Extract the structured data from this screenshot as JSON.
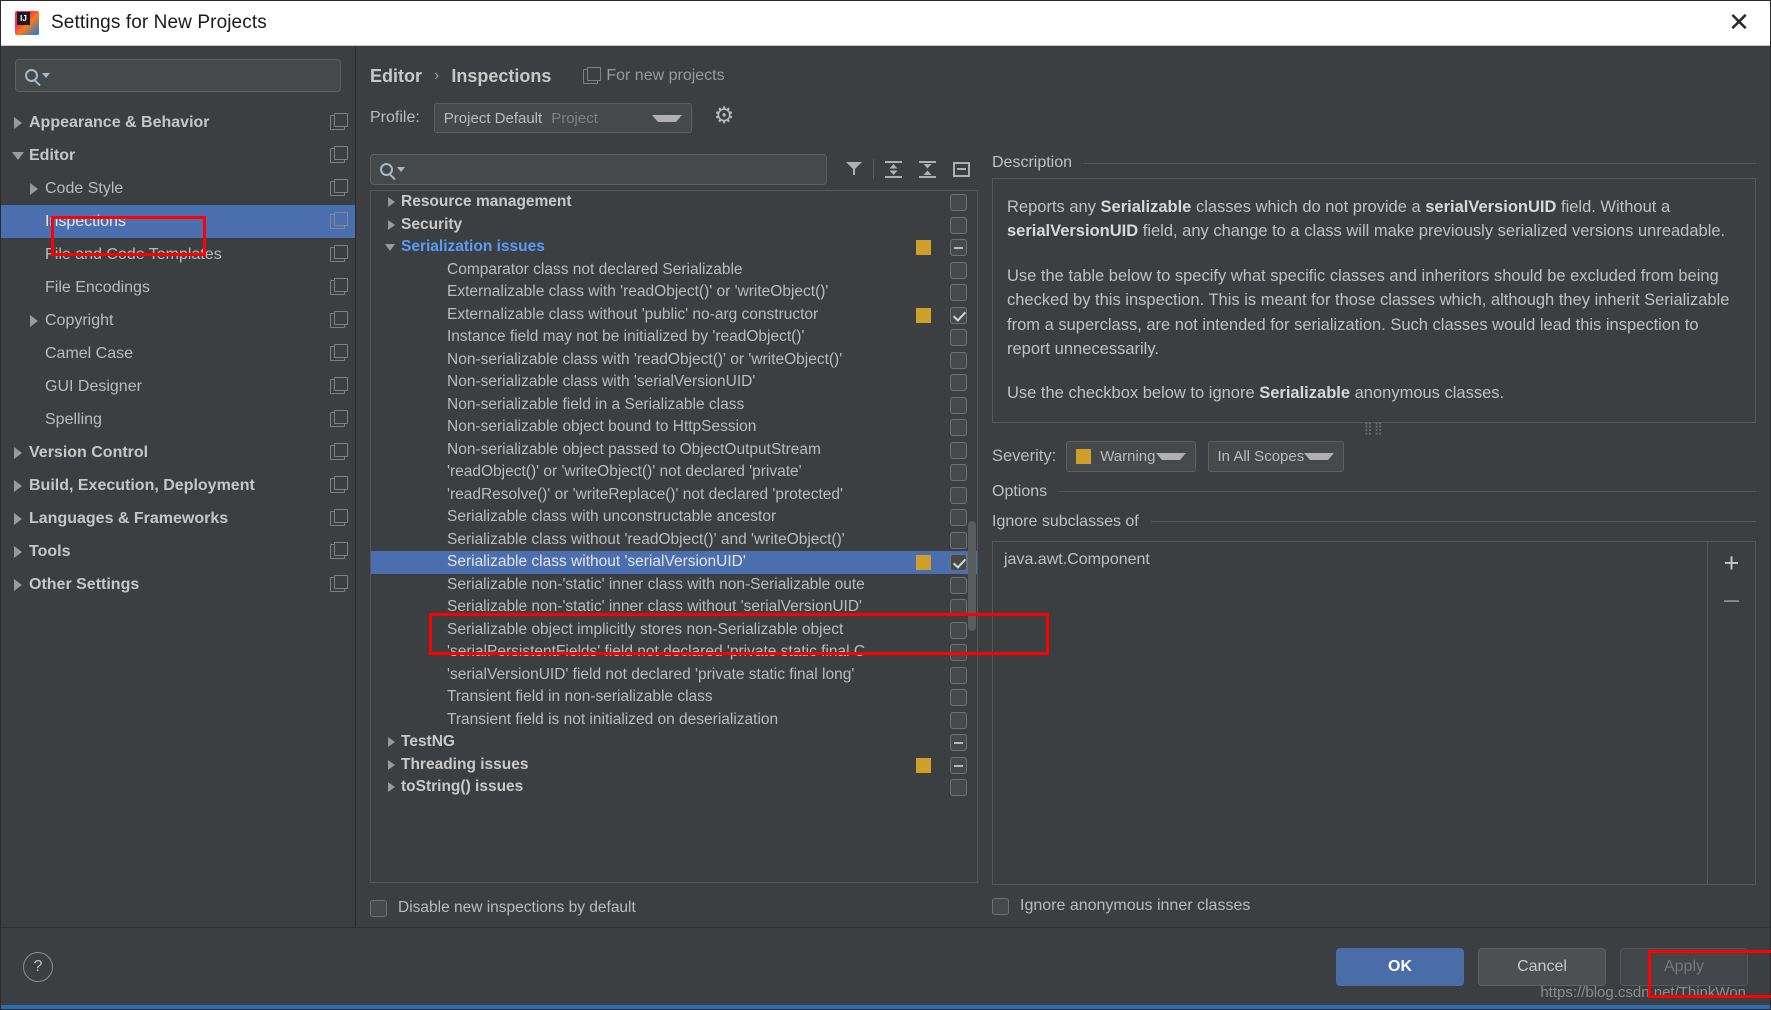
{
  "window": {
    "title": "Settings for New Projects",
    "close_label": "✕",
    "logo": "intellij-idea-logo"
  },
  "sidebar": {
    "search_placeholder": "",
    "search_value": "",
    "items": [
      {
        "label": "Appearance & Behavior",
        "level": 0,
        "bold": true,
        "arrow": "right",
        "selected": false
      },
      {
        "label": "Editor",
        "level": 0,
        "bold": true,
        "arrow": "down",
        "selected": false
      },
      {
        "label": "Code Style",
        "level": 1,
        "bold": false,
        "arrow": "right",
        "selected": false
      },
      {
        "label": "Inspections",
        "level": 1,
        "bold": false,
        "arrow": "none",
        "selected": true
      },
      {
        "label": "File and Code Templates",
        "level": 1,
        "bold": false,
        "arrow": "none",
        "selected": false
      },
      {
        "label": "File Encodings",
        "level": 1,
        "bold": false,
        "arrow": "none",
        "selected": false
      },
      {
        "label": "Copyright",
        "level": 1,
        "bold": false,
        "arrow": "right",
        "selected": false
      },
      {
        "label": "Camel Case",
        "level": 1,
        "bold": false,
        "arrow": "none",
        "selected": false
      },
      {
        "label": "GUI Designer",
        "level": 1,
        "bold": false,
        "arrow": "none",
        "selected": false
      },
      {
        "label": "Spelling",
        "level": 1,
        "bold": false,
        "arrow": "none",
        "selected": false
      },
      {
        "label": "Version Control",
        "level": 0,
        "bold": true,
        "arrow": "right",
        "selected": false
      },
      {
        "label": "Build, Execution, Deployment",
        "level": 0,
        "bold": true,
        "arrow": "right",
        "selected": false
      },
      {
        "label": "Languages & Frameworks",
        "level": 0,
        "bold": true,
        "arrow": "right",
        "selected": false
      },
      {
        "label": "Tools",
        "level": 0,
        "bold": true,
        "arrow": "right",
        "selected": false
      },
      {
        "label": "Other Settings",
        "level": 0,
        "bold": true,
        "arrow": "right",
        "selected": false
      }
    ]
  },
  "header": {
    "breadcrumb": [
      "Editor",
      "Inspections"
    ],
    "separator": "›",
    "for_new_projects": "For new projects",
    "profile_label": "Profile:",
    "profile_value": "Project Default",
    "profile_scope": "Project",
    "gear_icon": "gear-icon"
  },
  "inspections": {
    "search_value": "",
    "toolbar": [
      "filter-icon",
      "expand-all-icon",
      "collapse-all-icon",
      "minus-box-icon"
    ],
    "rows": [
      {
        "label": "Resource management",
        "type": "group",
        "arrow": "right",
        "active": false,
        "severity": false,
        "checkbox": "empty",
        "selected": false
      },
      {
        "label": "Security",
        "type": "group",
        "arrow": "right",
        "active": false,
        "severity": false,
        "checkbox": "empty",
        "selected": false
      },
      {
        "label": "Serialization issues",
        "type": "group",
        "arrow": "down",
        "active": true,
        "severity": true,
        "checkbox": "dash",
        "selected": false
      },
      {
        "label": "Comparator class not declared Serializable",
        "type": "leaf",
        "severity": false,
        "checkbox": "empty",
        "selected": false
      },
      {
        "label": "Externalizable class with 'readObject()' or 'writeObject()'",
        "type": "leaf",
        "severity": false,
        "checkbox": "empty",
        "selected": false
      },
      {
        "label": "Externalizable class without 'public' no-arg constructor",
        "type": "leaf",
        "severity": true,
        "checkbox": "checked",
        "selected": false
      },
      {
        "label": "Instance field may not be initialized by 'readObject()'",
        "type": "leaf",
        "severity": false,
        "checkbox": "empty",
        "selected": false
      },
      {
        "label": "Non-serializable class with 'readObject()' or 'writeObject()'",
        "type": "leaf",
        "severity": false,
        "checkbox": "empty",
        "selected": false
      },
      {
        "label": "Non-serializable class with 'serialVersionUID'",
        "type": "leaf",
        "severity": false,
        "checkbox": "empty",
        "selected": false
      },
      {
        "label": "Non-serializable field in a Serializable class",
        "type": "leaf",
        "severity": false,
        "checkbox": "empty",
        "selected": false
      },
      {
        "label": "Non-serializable object bound to HttpSession",
        "type": "leaf",
        "severity": false,
        "checkbox": "empty",
        "selected": false
      },
      {
        "label": "Non-serializable object passed to ObjectOutputStream",
        "type": "leaf",
        "severity": false,
        "checkbox": "empty",
        "selected": false
      },
      {
        "label": "'readObject()' or 'writeObject()' not declared 'private'",
        "type": "leaf",
        "severity": false,
        "checkbox": "empty",
        "selected": false
      },
      {
        "label": "'readResolve()' or 'writeReplace()' not declared 'protected'",
        "type": "leaf",
        "severity": false,
        "checkbox": "empty",
        "selected": false
      },
      {
        "label": "Serializable class with unconstructable ancestor",
        "type": "leaf",
        "severity": false,
        "checkbox": "empty",
        "selected": false
      },
      {
        "label": "Serializable class without 'readObject()' and 'writeObject()'",
        "type": "leaf",
        "severity": false,
        "checkbox": "empty",
        "selected": false
      },
      {
        "label": "Serializable class without 'serialVersionUID'",
        "type": "leaf",
        "severity": true,
        "checkbox": "checked",
        "selected": true
      },
      {
        "label": "Serializable non-'static' inner class with non-Serializable oute",
        "type": "leaf",
        "severity": false,
        "checkbox": "empty",
        "selected": false
      },
      {
        "label": "Serializable non-'static' inner class without 'serialVersionUID'",
        "type": "leaf",
        "severity": false,
        "checkbox": "empty",
        "selected": false
      },
      {
        "label": "Serializable object implicitly stores non-Serializable object",
        "type": "leaf",
        "severity": false,
        "checkbox": "empty",
        "selected": false
      },
      {
        "label": "'serialPersistentFields' field not declared 'private static final C",
        "type": "leaf",
        "severity": false,
        "checkbox": "empty",
        "selected": false
      },
      {
        "label": "'serialVersionUID' field not declared 'private static final long'",
        "type": "leaf",
        "severity": false,
        "checkbox": "empty",
        "selected": false
      },
      {
        "label": "Transient field in non-serializable class",
        "type": "leaf",
        "severity": false,
        "checkbox": "empty",
        "selected": false
      },
      {
        "label": "Transient field is not initialized on deserialization",
        "type": "leaf",
        "severity": false,
        "checkbox": "empty",
        "selected": false
      },
      {
        "label": "TestNG",
        "type": "group",
        "arrow": "right",
        "active": false,
        "severity": false,
        "checkbox": "dash",
        "selected": false
      },
      {
        "label": "Threading issues",
        "type": "group",
        "arrow": "right",
        "active": false,
        "severity": true,
        "checkbox": "dash",
        "selected": false
      },
      {
        "label": "toString() issues",
        "type": "group",
        "arrow": "right",
        "active": false,
        "severity": false,
        "checkbox": "empty",
        "selected": false
      }
    ],
    "disable_new_label": "Disable new inspections by default",
    "disable_new_checked": false
  },
  "description": {
    "section_title": "Description",
    "paragraphs": [
      "Reports any <b>Serializable</b> classes which do not provide a <b>serialVersionUID</b> field. Without a <b>serialVersionUID</b> field, any change to a class will make previously serialized versions unreadable.",
      "Use the table below to specify what specific classes and inheritors should be excluded from being checked by this inspection. This is meant for those classes which, although they inherit Serializable from a superclass, are not intended for serialization. Such classes would lead this inspection to report unnecessarily.",
      "Use the checkbox below to ignore <b>Serializable</b> anonymous classes."
    ]
  },
  "severity": {
    "label": "Severity:",
    "value": "Warning",
    "color": "#cf9f2b",
    "scope_value": "In All Scopes"
  },
  "options": {
    "section_title": "Options",
    "ignore_subclasses_title": "Ignore subclasses of",
    "entries": [
      "java.awt.Component"
    ],
    "add_label": "+",
    "remove_label": "–",
    "anonymous_label": "Ignore anonymous inner classes",
    "anonymous_checked": false
  },
  "footer": {
    "help_label": "?",
    "ok_label": "OK",
    "cancel_label": "Cancel",
    "apply_label": "Apply",
    "watermark": "https://blog.csdn.net/ThinkWon"
  }
}
